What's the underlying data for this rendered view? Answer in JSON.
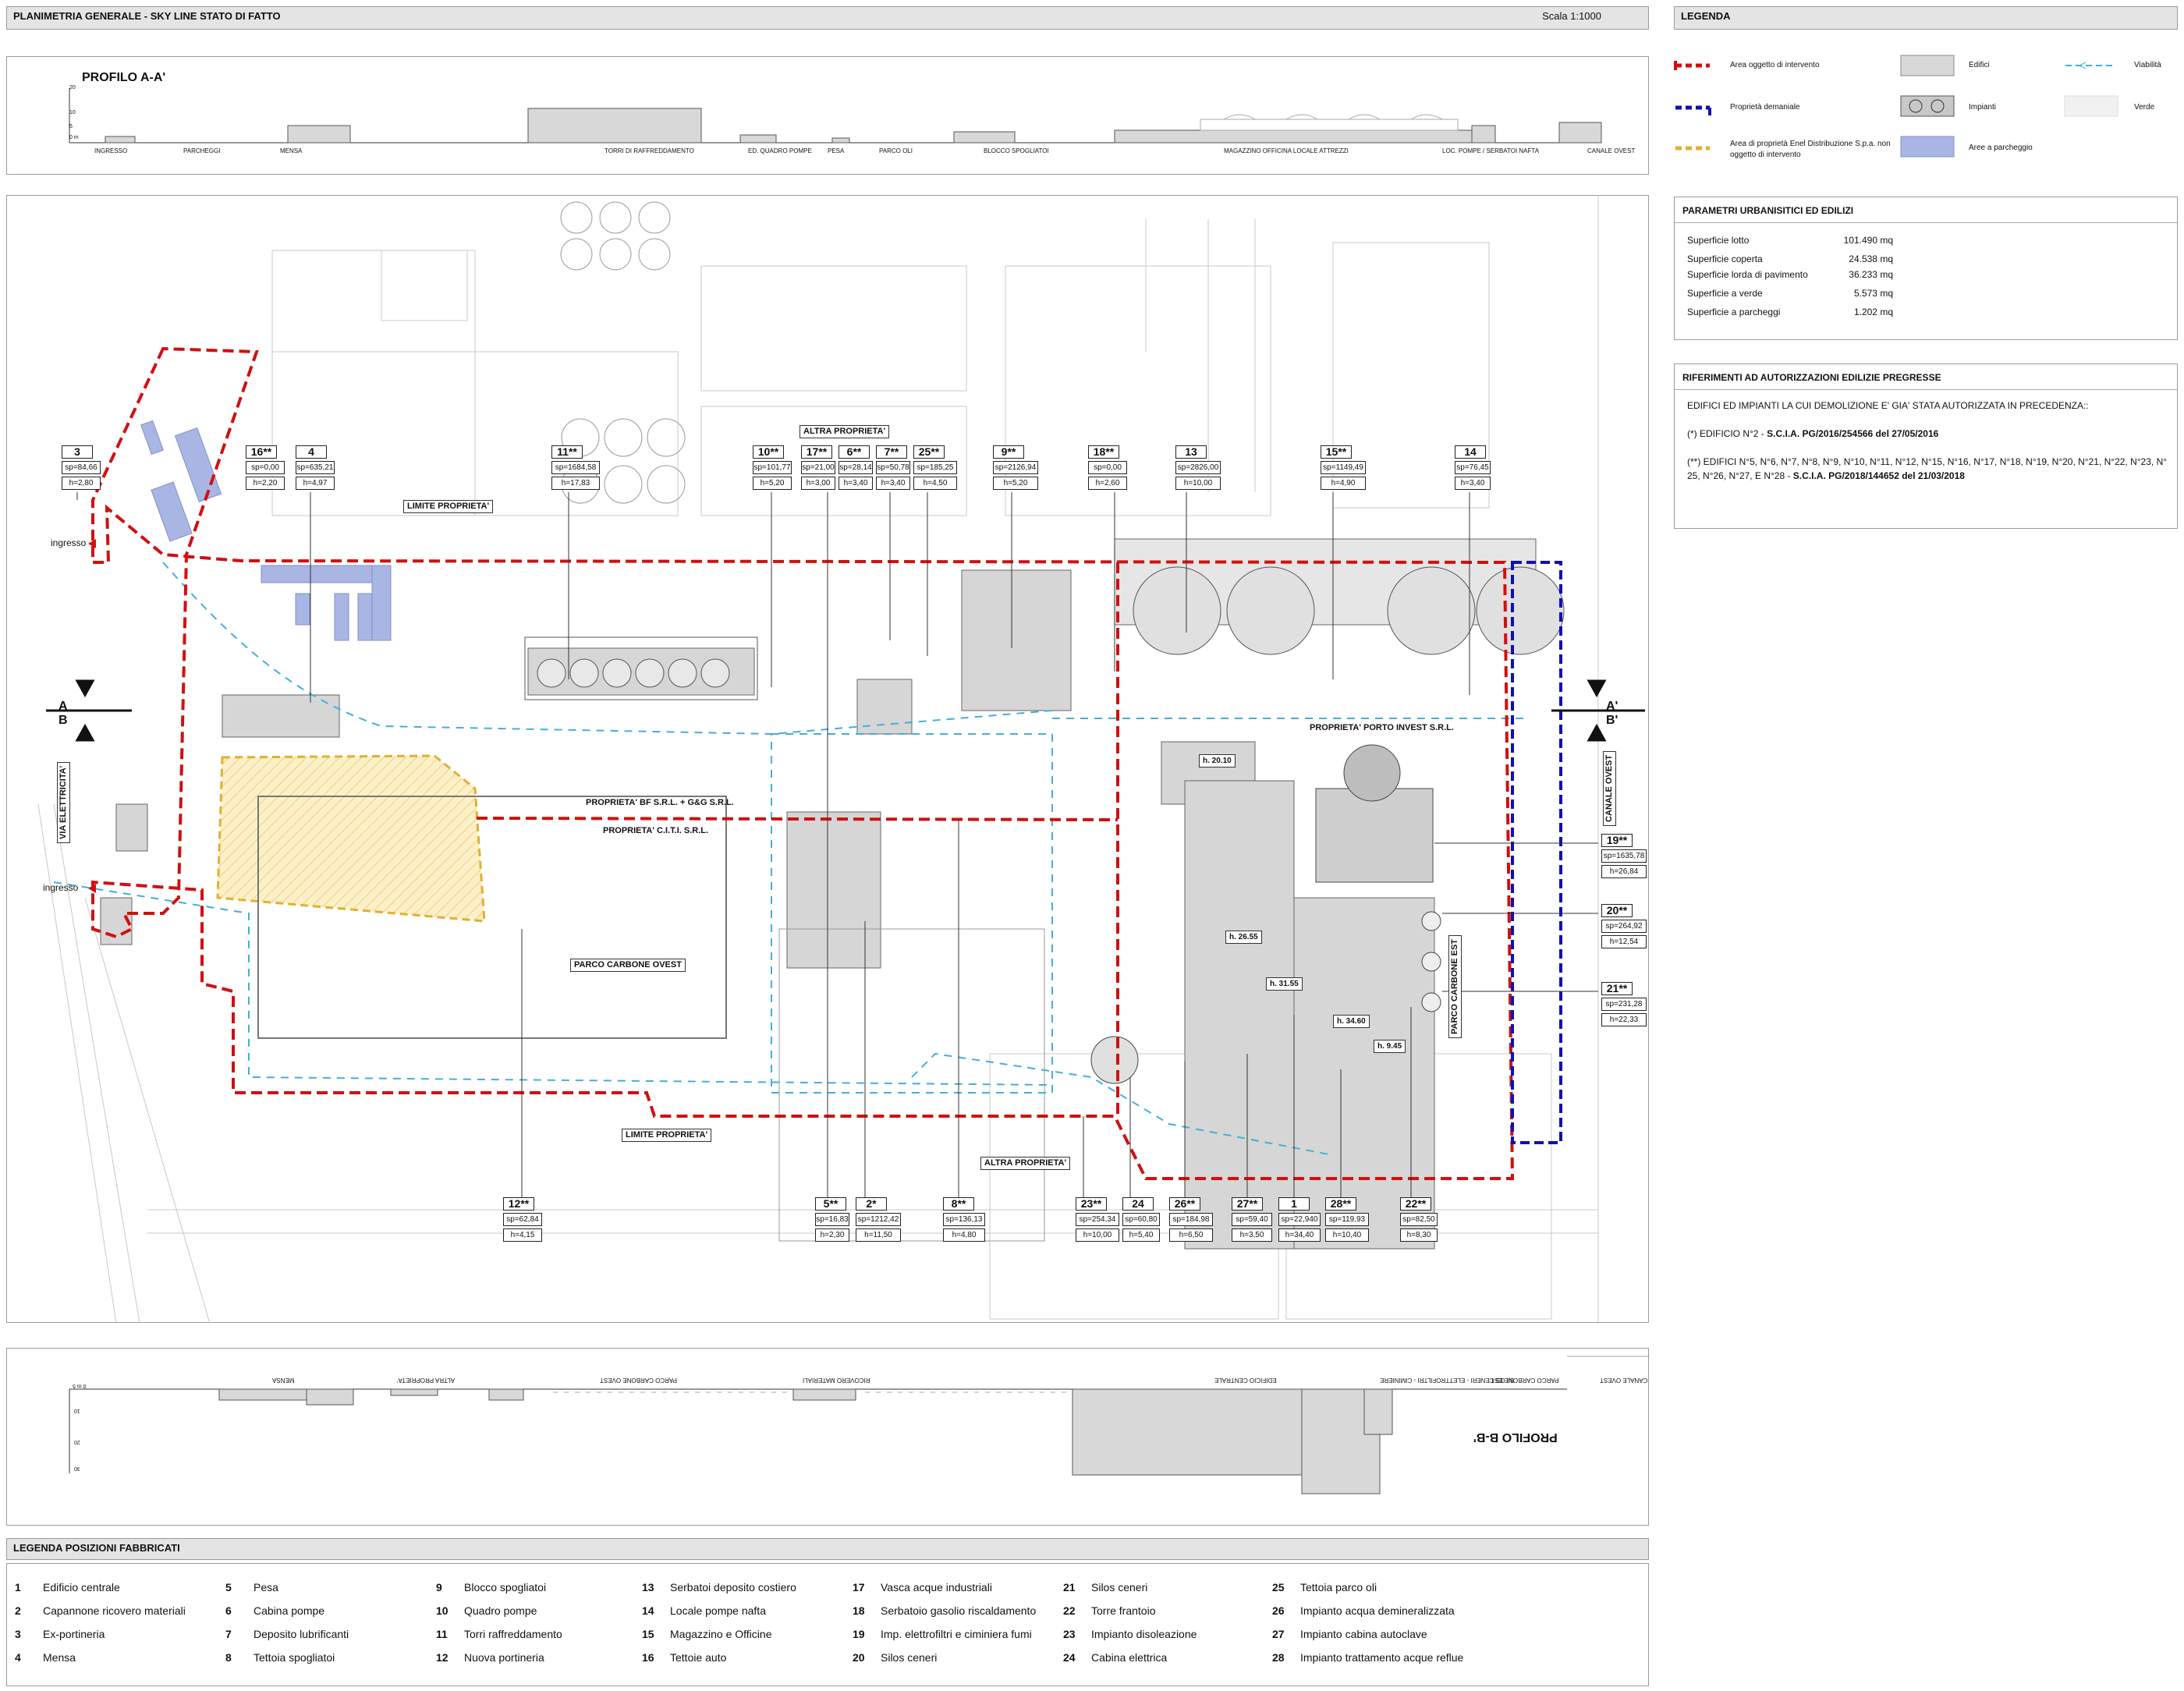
{
  "title_bar": {
    "title": "PLANIMETRIA GENERALE - SKY LINE STATO DI FATTO",
    "scale": "Scala 1:1000"
  },
  "legend": {
    "title": "LEGENDA",
    "items": [
      {
        "label": "Area oggetto di intervento",
        "kind": "line-red"
      },
      {
        "label": "Proprietà demaniale",
        "kind": "line-blue"
      },
      {
        "label": "Area di proprietà Enel Distribuzione S.p.a. non oggetto di intervento",
        "kind": "hatch-yellow"
      },
      {
        "label": "Edifici",
        "kind": "fill-grey"
      },
      {
        "label": "Impianti",
        "kind": "fill-plant"
      },
      {
        "label": "Aree a parcheggio",
        "kind": "fill-blue"
      },
      {
        "label": "Viabilità",
        "kind": "arrow-cyan"
      },
      {
        "label": "Verde",
        "kind": "fill-light"
      }
    ]
  },
  "parametri": {
    "title": "PARAMETRI URBANISITICI ED EDILIZI",
    "rows": [
      {
        "label": "Superficie lotto",
        "value": "101.490 mq"
      },
      {
        "label": "Superficie coperta",
        "value": "24.538 mq"
      },
      {
        "label": "Superficie lorda di pavimento",
        "value": "36.233 mq"
      },
      {
        "label": "Superficie a verde",
        "value": "5.573 mq"
      },
      {
        "label": "Superficie a parcheggi",
        "value": "1.202 mq"
      }
    ]
  },
  "riferimenti": {
    "title": "RIFERIMENTI AD AUTORIZZAZIONI EDILIZIE PREGRESSE",
    "intro": "EDIFICI ED IMPIANTI LA CUI DEMOLIZIONE E' GIA' STATA AUTORIZZATA IN PRECEDENZA::",
    "p1_prefix": "(*) EDIFICIO N°2 - ",
    "p1_ref": "S.C.I.A. PG/2016/254566 del 27/05/2016",
    "p2_prefix": "(**) EDIFICI N°5, N°6, N°7, N°8, N°9, N°10, N°11, N°12, N°15, N°16, N°17, N°18, N°19, N°20, N°21, N°22, N°23, N° 25, N°26, N°27, E N°28  - ",
    "p2_ref": "S.C.I.A. PG/2018/144652 del 21/03/2018"
  },
  "profilo_a": {
    "title": "PROFILO A-A'",
    "scale_ticks": [
      "20",
      "10",
      "5",
      "0 m"
    ],
    "labels": [
      "INGRESSO",
      "PARCHEGGI",
      "MENSA",
      "TORRI DI RAFFREDDAMENTO",
      "ED. QUADRO POMPE",
      "PESA",
      "PARCO OLI",
      "BLOCCO SPOGLIATOI",
      "MAGAZZINO OFFICINA LOCALE ATTREZZI",
      "LOC. POMPE / SERBATOI NAFTA",
      "CANALE OVEST"
    ]
  },
  "profilo_b": {
    "title": "PROFILO B-B'",
    "scale_ticks": [
      "0 m 5",
      "10",
      "20",
      "30"
    ],
    "labels": [
      "MENSA",
      "ALTRA PROPRIETA'",
      "PARCO CARBONE OVEST",
      "RICOVERO MATERIALI",
      "EDIFICIO CENTRALE",
      "SILOS CENERI - ELETTROFILTRI - CIMINIERE",
      "PARCO CARBONE EST",
      "CANALE OVEST"
    ]
  },
  "plan_labels": {
    "limite_top": "LIMITE PROPRIETA'",
    "limite_bottom": "LIMITE PROPRIETA'",
    "altra_top": "ALTRA PROPRIETA'",
    "altra_bottom": "ALTRA PROPRIETA'",
    "porto_invest": "PROPRIETA' PORTO INVEST S.R.L.",
    "bf": "PROPRIETA' BF S.R.L. + G&G S.R.L.",
    "citi": "PROPRIETA' C.I.T.I. S.R.L.",
    "parco_ovest": "PARCO CARBONE OVEST",
    "parco_est": "PARCO CARBONE EST",
    "canale_ovest": "CANALE OVEST",
    "via": "VIA ELETTRICITA'",
    "ingresso1": "ingresso",
    "ingresso2": "ingresso",
    "sec_a": "A",
    "sec_b": "B",
    "sec_a2": "A'",
    "sec_b2": "B'",
    "heights": [
      "h. 20.10",
      "h. 26.55",
      "h. 31.55",
      "h. 34.60",
      "h. 9.45"
    ]
  },
  "tags": [
    {
      "n": "3",
      "sp": "sp=84,66",
      "h": "h=2,80"
    },
    {
      "n": "16**",
      "sp": "sp=0,00",
      "h": "h=2,20"
    },
    {
      "n": "4",
      "sp": "sp=635,21",
      "h": "h=4,97"
    },
    {
      "n": "11**",
      "sp": "sp=1684,58",
      "h": "h=17,83"
    },
    {
      "n": "10**",
      "sp": "sp=101,77",
      "h": "h=5,20"
    },
    {
      "n": "17**",
      "sp": "sp=21,00",
      "h": "h=3,00"
    },
    {
      "n": "6**",
      "sp": "sp=28,14",
      "h": "h=3,40"
    },
    {
      "n": "7**",
      "sp": "sp=50,78",
      "h": "h=3,40"
    },
    {
      "n": "25**",
      "sp": "sp=185,25",
      "h": "h=4,50"
    },
    {
      "n": "9**",
      "sp": "sp=2126,94",
      "h": "h=5,20"
    },
    {
      "n": "18**",
      "sp": "sp=0,00",
      "h": "h=2,60"
    },
    {
      "n": "13",
      "sp": "sp=2826,00",
      "h": "h=10,00"
    },
    {
      "n": "15**",
      "sp": "sp=1149,49",
      "h": "h=4,90"
    },
    {
      "n": "14",
      "sp": "sp=76,45",
      "h": "h=3,40"
    },
    {
      "n": "19**",
      "sp": "sp=1635,78",
      "h": "h=26,84"
    },
    {
      "n": "20**",
      "sp": "sp=264,92",
      "h": "h=12,54"
    },
    {
      "n": "21**",
      "sp": "sp=231,28",
      "h": "h=22,33"
    },
    {
      "n": "12**",
      "sp": "sp=62,84",
      "h": "h=4,15"
    },
    {
      "n": "5**",
      "sp": "sp=16,83",
      "h": "h=2,30"
    },
    {
      "n": "2*",
      "sp": "sp=1212,42",
      "h": "h=11,50"
    },
    {
      "n": "8**",
      "sp": "sp=136,13",
      "h": "h=4,80"
    },
    {
      "n": "23**",
      "sp": "sp=254,34",
      "h": "h=10,00"
    },
    {
      "n": "24",
      "sp": "sp=60,80",
      "h": "h=5,40"
    },
    {
      "n": "26**",
      "sp": "sp=184,98",
      "h": "h=6,50"
    },
    {
      "n": "27**",
      "sp": "sp=59,40",
      "h": "h=3,50"
    },
    {
      "n": "1",
      "sp": "sp=22,940",
      "h": "h=34,40"
    },
    {
      "n": "28**",
      "sp": "sp=119,93",
      "h": "h=10,40"
    },
    {
      "n": "22**",
      "sp": "sp=82,50",
      "h": "h=8,30"
    }
  ],
  "posizioni": {
    "title": "LEGENDA POSIZIONI FABBRICATI",
    "items": [
      {
        "n": "1",
        "label": "Edificio centrale"
      },
      {
        "n": "2",
        "label": "Capannone ricovero materiali"
      },
      {
        "n": "3",
        "label": "Ex-portineria"
      },
      {
        "n": "4",
        "label": "Mensa"
      },
      {
        "n": "5",
        "label": "Pesa"
      },
      {
        "n": "6",
        "label": "Cabina pompe"
      },
      {
        "n": "7",
        "label": "Deposito lubrificanti"
      },
      {
        "n": "8",
        "label": "Tettoia spogliatoi"
      },
      {
        "n": "9",
        "label": "Blocco spogliatoi"
      },
      {
        "n": "10",
        "label": "Quadro pompe"
      },
      {
        "n": "11",
        "label": "Torri raffreddamento"
      },
      {
        "n": "12",
        "label": "Nuova portineria"
      },
      {
        "n": "13",
        "label": "Serbatoi deposito costiero"
      },
      {
        "n": "14",
        "label": "Locale pompe nafta"
      },
      {
        "n": "15",
        "label": "Magazzino e Officine"
      },
      {
        "n": "16",
        "label": "Tettoie auto"
      },
      {
        "n": "17",
        "label": "Vasca acque industriali"
      },
      {
        "n": "18",
        "label": "Serbatoio gasolio riscaldamento"
      },
      {
        "n": "19",
        "label": "Imp. elettrofiltri e ciminiera fumi"
      },
      {
        "n": "20",
        "label": "Silos ceneri"
      },
      {
        "n": "21",
        "label": "Silos ceneri"
      },
      {
        "n": "22",
        "label": "Torre frantoio"
      },
      {
        "n": "23",
        "label": "Impianto disoleazione"
      },
      {
        "n": "24",
        "label": "Cabina elettrica"
      },
      {
        "n": "25",
        "label": "Tettoia parco oli"
      },
      {
        "n": "26",
        "label": "Impianto acqua demineralizzata"
      },
      {
        "n": "27",
        "label": "Impianto cabina autoclave"
      },
      {
        "n": "28",
        "label": "Impianto trattamento acque reflue"
      }
    ]
  }
}
